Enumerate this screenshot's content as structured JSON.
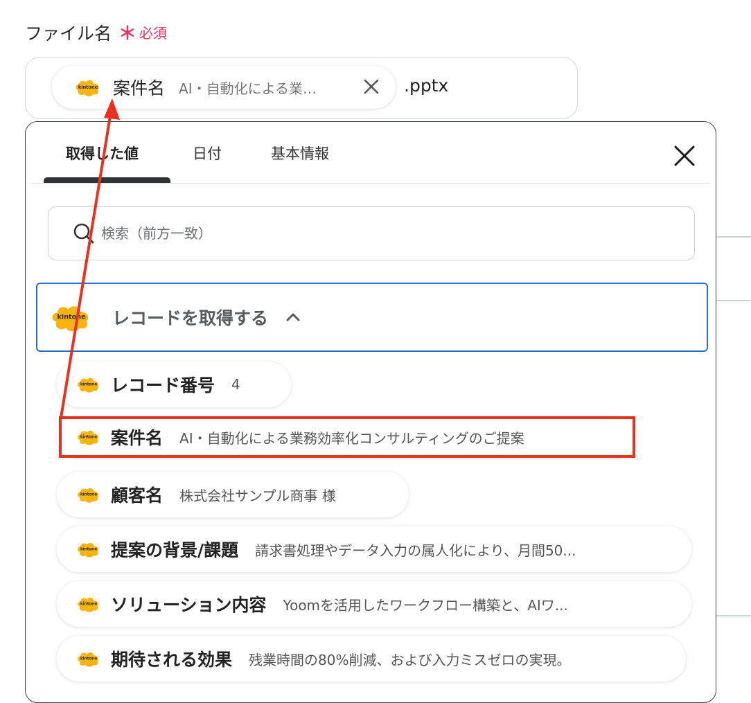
{
  "field": {
    "label": "ファイル名",
    "required_mark": "＊",
    "required_text": "必須",
    "extension": ".pptx",
    "token": {
      "logo_text": "kintone",
      "name": "案件名",
      "value": "AI・自動化による業…"
    }
  },
  "panel": {
    "tabs": [
      {
        "label": "取得した値",
        "active": true
      },
      {
        "label": "日付",
        "active": false
      },
      {
        "label": "基本情報",
        "active": false
      }
    ],
    "search": {
      "placeholder": "検索（前方一致）"
    },
    "group": {
      "logo_text": "kintone",
      "title": "レコードを取得する",
      "expanded": true
    },
    "items": [
      {
        "name": "レコード番号",
        "value": "4"
      },
      {
        "name": "案件名",
        "value": "AI・自動化による業務効率化コンサルティングのご提案"
      },
      {
        "name": "顧客名",
        "value": "株式会社サンプル商事 様"
      },
      {
        "name": "提案の背景/課題",
        "value": "請求書処理やデータ入力の属人化により、月間50..."
      },
      {
        "name": "ソリューション内容",
        "value": "Yoomを活用したワークフロー構築と、AIワ..."
      },
      {
        "name": "期待される効果",
        "value": "残業時間の80%削減、および入力ミスゼロの実現。"
      }
    ],
    "logo_text": "kintone"
  },
  "colors": {
    "required": "#e8365d",
    "kintone_yellow": "#fbb40f",
    "selected_border": "#2a6fcf",
    "annotation": "#e8311e"
  }
}
